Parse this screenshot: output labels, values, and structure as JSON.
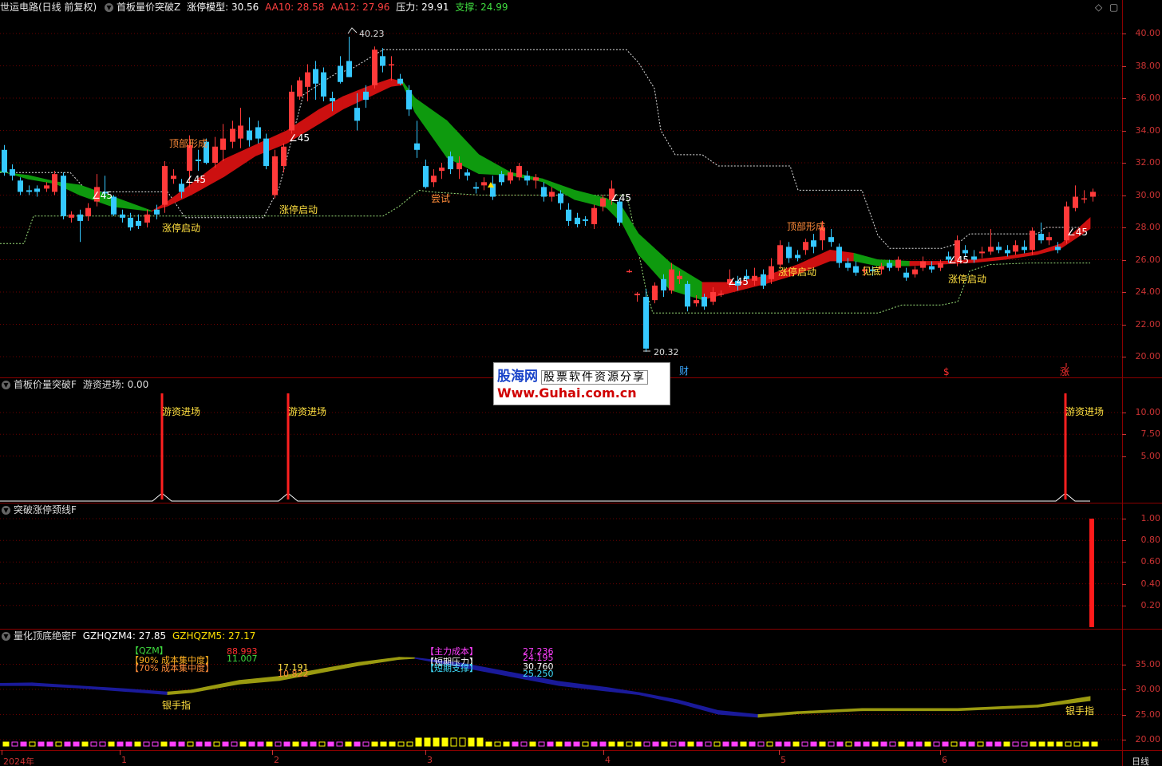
{
  "main_panel": {
    "header": {
      "stock": "世运电路(日线 前复权)",
      "indicator": "首板量价突破Z",
      "model_label": "涨停模型:",
      "model_value": "30.56",
      "aa10": "AA10: 28.58",
      "aa12": "AA12: 27.96",
      "pressure": "压力: 29.91",
      "support": "支撑: 24.99"
    },
    "icons": {
      "diamond": "diamond-icon",
      "restore": "restore-window-icon"
    },
    "price_axis": [
      "40.00",
      "38.00",
      "36.00",
      "34.00",
      "32.00",
      "30.00",
      "28.00",
      "26.00",
      "24.00",
      "22.00",
      "20.00"
    ],
    "price_range": [
      19.0,
      41.0
    ],
    "annotations": {
      "high": "40.23",
      "low": "20.32",
      "a45": "45",
      "top_form": "顶部形成",
      "limit_start": "涨停启动",
      "try": "尝试",
      "see_bottom": "见底"
    },
    "markers": {
      "cai": "财",
      "s": "$",
      "zhang": "涨"
    },
    "colors": {
      "up": "#ff3a3a",
      "down": "#35c8ff",
      "bull_ribbon": "#cc1010",
      "bear_ribbon": "#0e9a0e"
    }
  },
  "panel2": {
    "title": "首板价量突破F",
    "field": "游资进场: 0.00",
    "axis": [
      "10.00",
      "7.50",
      "5.00"
    ],
    "label": "游资进场"
  },
  "panel3": {
    "title": "突破涨停颈线F",
    "axis": [
      "1.00",
      "0.80",
      "0.60",
      "0.40",
      "0.20"
    ],
    "bar_value": 1.0
  },
  "panel4": {
    "title": "量化顶底绝密F",
    "f1": "GZHQZM4: 27.85",
    "f2": "GZHQZM5: 27.17",
    "axis": [
      "35.00",
      "30.00",
      "25.00",
      "20.00"
    ],
    "legend_left": {
      "qzm": "【QZM】",
      "l90": "【90% 成本集中度】",
      "l70": "【70% 成本集中度】",
      "v1": "88.993",
      "v2": "11.007",
      "v3": "17.191",
      "v4": "10.822"
    },
    "legend_right": {
      "l1": "【主力成本】",
      "l2": "【短期压力】",
      "l3": "【短期支撑】",
      "v1": "27.236",
      "v2": "24.195",
      "v3": "30.760",
      "v4": "25.250"
    },
    "label": "银手指"
  },
  "date_axis": {
    "labels": [
      "2024年",
      "1",
      "2",
      "3",
      "4",
      "5",
      "6"
    ],
    "period": "日线"
  },
  "watermark": {
    "brand": "股海网",
    "sub": "股票软件资源分享",
    "url": "Www.Guhai.com.cn"
  }
}
